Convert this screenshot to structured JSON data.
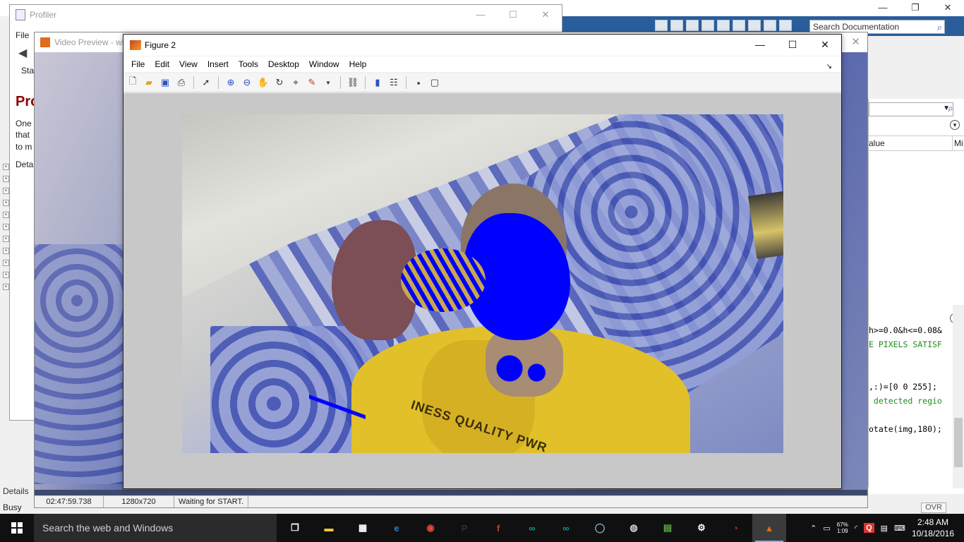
{
  "matlab": {
    "window_buttons": {
      "minimize": "—",
      "restore": "❐",
      "close": "✕"
    },
    "search_placeholder": "Search Documentation",
    "workspace_header": {
      "col1": "alue",
      "col2": "Mi"
    },
    "code_lines": [
      {
        "text": "h>=0.0&h<=0.08&",
        "type": "plain"
      },
      {
        "text": "E PIXELS SATISF",
        "type": "cmt"
      },
      {
        "text": "",
        "type": "plain"
      },
      {
        "text": "",
        "type": "plain"
      },
      {
        "text": ",:)=[0 0 255];",
        "type": "plain"
      },
      {
        "text": " detected regio",
        "type": "cmt"
      },
      {
        "text": "",
        "type": "plain"
      },
      {
        "text": "otate(img,180);",
        "type": "plain"
      }
    ],
    "status_busy": "Busy",
    "status_ovr": "OVR"
  },
  "profiler": {
    "title": "Profiler",
    "window_buttons": {
      "minimize": "—",
      "restore": "☐",
      "close": "✕"
    },
    "menu_file": "File",
    "start_label": "Star",
    "heading": "Pro",
    "lines": [
      "One",
      "that",
      "to m"
    ],
    "deta_label": "Deta",
    "details_tab": "Details"
  },
  "video_preview": {
    "title": "Video Preview - wi",
    "close": "✕",
    "status": {
      "timestamp": "02:47:59.738",
      "resolution": "1280x720",
      "message": "Waiting for START."
    }
  },
  "figure": {
    "title": "Figure 2",
    "window_buttons": {
      "minimize": "—",
      "maximize": "☐",
      "close": "✕"
    },
    "menu": [
      "File",
      "Edit",
      "View",
      "Insert",
      "Tools",
      "Desktop",
      "Window",
      "Help"
    ],
    "toolbar_icons": [
      "new-figure-icon",
      "open-file-icon",
      "save-icon",
      "print-icon",
      "edit-plot-pointer-icon",
      "zoom-in-icon",
      "zoom-out-icon",
      "pan-hand-icon",
      "rotate-3d-icon",
      "data-cursor-icon",
      "brush-icon",
      "link-plot-icon",
      "colorbar-icon",
      "legend-icon",
      "hide-plot-tools-icon",
      "show-plot-tools-icon"
    ],
    "image_text": "INESS QUALITY PWR"
  },
  "taskbar": {
    "search_text": "Search the web and Windows",
    "apps": [
      {
        "name": "task-view",
        "glyph": "❐",
        "color": "#ffffff"
      },
      {
        "name": "file-explorer",
        "glyph": "▬",
        "color": "#f5c542"
      },
      {
        "name": "store",
        "glyph": "▦",
        "color": "#ffffff"
      },
      {
        "name": "edge",
        "glyph": "e",
        "color": "#2d7dd2"
      },
      {
        "name": "chrome",
        "glyph": "◉",
        "color": "#e8453c"
      },
      {
        "name": "p-app",
        "glyph": "P",
        "color": "#2f2f2f"
      },
      {
        "name": "fritzing",
        "glyph": "f",
        "color": "#d03b2f"
      },
      {
        "name": "arduino-1",
        "glyph": "∞",
        "color": "#14979d"
      },
      {
        "name": "arduino-2",
        "glyph": "∞",
        "color": "#14979d"
      },
      {
        "name": "ring-app",
        "glyph": "◯",
        "color": "#8aa6c1"
      },
      {
        "name": "camera-app",
        "glyph": "◍",
        "color": "#cfcfcf"
      },
      {
        "name": "chart-app",
        "glyph": "▤",
        "color": "#5aa545"
      },
      {
        "name": "settings",
        "glyph": "⚙",
        "color": "#ffffff"
      },
      {
        "name": "gauge-app",
        "glyph": "◔",
        "color": "#c0392b"
      },
      {
        "name": "matlab",
        "glyph": "▲",
        "color": "#e66c1b"
      }
    ],
    "active_app": "matlab",
    "battery": {
      "percent": "67%",
      "time": "1:09"
    },
    "clock": {
      "time": "2:48 AM",
      "date": "10/18/2016"
    }
  }
}
